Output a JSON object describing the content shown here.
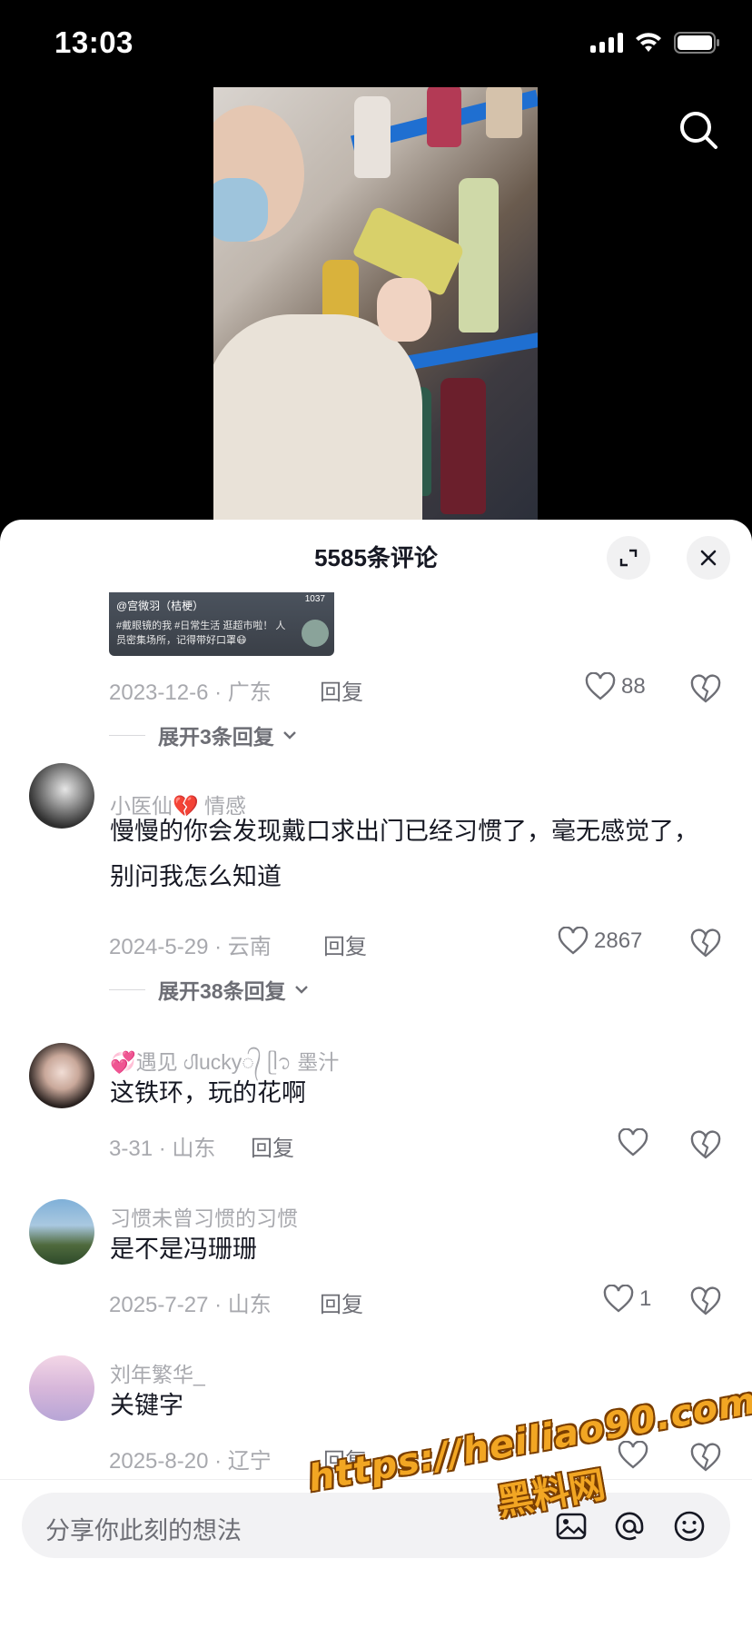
{
  "status_bar": {
    "time": "13:03"
  },
  "sheet": {
    "title": "5585条评论"
  },
  "pinned_thumbnail": {
    "line1": "@宫微羽（桔梗）",
    "line2": "#戴眼镜的我 #日常生活 逛超市啦！ 人",
    "line3": "员密集场所，记得带好口罩😷",
    "count": "1037"
  },
  "comments": [
    {
      "id": "c0",
      "date_location": "2023-12-6 · 广东",
      "reply": "回复",
      "likes": "88",
      "expand": "展开3条回复"
    },
    {
      "id": "c1",
      "username": "小医仙💔 情感",
      "text": "慢慢的你会发现戴口求出门已经习惯了，毫无感觉了，别问我怎么知道",
      "date_location": "2024-5-29 · 云南",
      "reply": "回复",
      "likes": "2867",
      "expand": "展开38条回复"
    },
    {
      "id": "c2",
      "username": "💞遇见 ᦔlucky᭄ ᥫ᭡ 墨汁",
      "text": "这铁环，玩的花啊",
      "date_location": "3-31 · 山东",
      "reply": "回复",
      "likes": ""
    },
    {
      "id": "c3",
      "username": "习惯未曾习惯的习惯",
      "text": "是不是冯珊珊",
      "date_location": "2025-7-27 · 山东",
      "reply": "回复",
      "likes": "1"
    },
    {
      "id": "c4",
      "username": "刘年繁华_",
      "text": "关键字",
      "date_location": "2025-8-20 · 辽宁",
      "reply": "回复",
      "likes": ""
    }
  ],
  "input": {
    "placeholder": "分享你此刻的想法"
  },
  "watermark": {
    "url": "https://heiliao90.com",
    "name": "黑料网"
  },
  "colors": {
    "accent_watermark": "#f2a623",
    "text_primary": "#161823",
    "text_secondary": "#a8a9ae",
    "sheet_bg": "#ffffff"
  },
  "icons": [
    "search-icon",
    "expand-icon",
    "close-icon",
    "heart-icon",
    "broken-heart-icon",
    "image-icon",
    "at-icon",
    "emoji-icon",
    "wifi-icon",
    "battery-icon",
    "signal-icon",
    "chevron-down-icon"
  ]
}
